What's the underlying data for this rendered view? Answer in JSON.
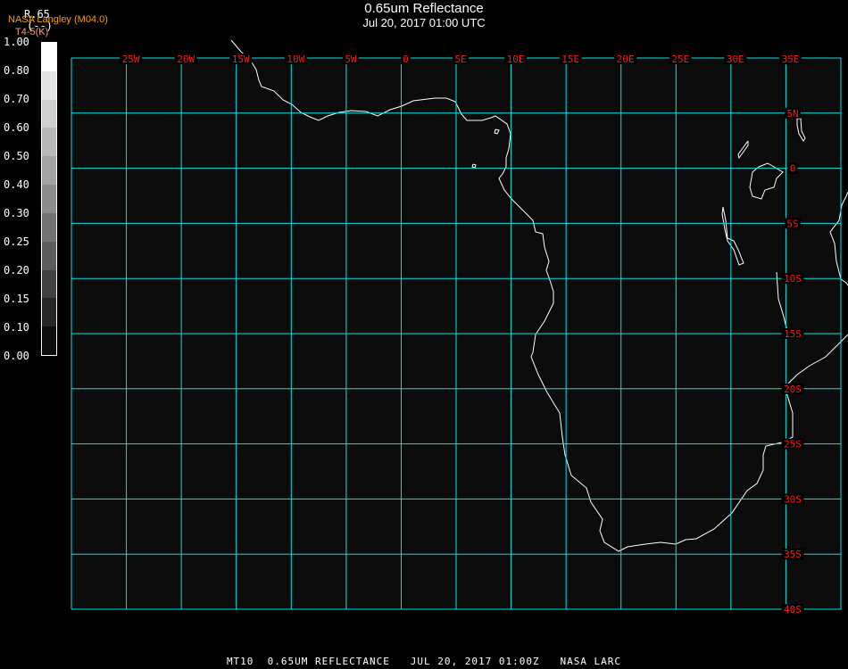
{
  "header": {
    "title": "0.65um Reflectance",
    "subtitle": "Jul 20, 2017 01:00 UTC"
  },
  "legend": {
    "variable": "R.65",
    "units": "(--)",
    "organization": "NASA Langley (M04.0)",
    "secondary": "T4-5(K)",
    "ticks": [
      "1.00",
      "0.80",
      "0.70",
      "0.60",
      "0.50",
      "0.40",
      "0.30",
      "0.25",
      "0.20",
      "0.15",
      "0.10",
      "0.00"
    ],
    "band_colors": [
      "#ffffff",
      "#e4e4e4",
      "#cfcfcf",
      "#b9b9b9",
      "#a3a3a3",
      "#8c8c8c",
      "#737373",
      "#5c5c5c",
      "#404040",
      "#262626",
      "#0d0d0d"
    ]
  },
  "map": {
    "lon_range": [
      -30,
      40
    ],
    "lat_range": [
      -40,
      10
    ],
    "grid_spacing_deg": 5,
    "lon_labels": [
      "25W",
      "20W",
      "15W",
      "10W",
      "5W",
      "0",
      "5E",
      "10E",
      "15E",
      "20E",
      "25E",
      "30E",
      "35E"
    ],
    "lat_labels": [
      "5N",
      "0",
      "5S",
      "10S",
      "15S",
      "20S",
      "25S",
      "30S",
      "35S",
      "40S"
    ],
    "colors": {
      "background": "#0b0b0b",
      "grid": "#00e5e5",
      "labels": "#ff1a1a",
      "coastline": "#ffffff"
    }
  },
  "footer": {
    "text": "MT10  0.65UM REFLECTANCE   JUL 20, 2017 01:00Z   NASA LARC"
  }
}
